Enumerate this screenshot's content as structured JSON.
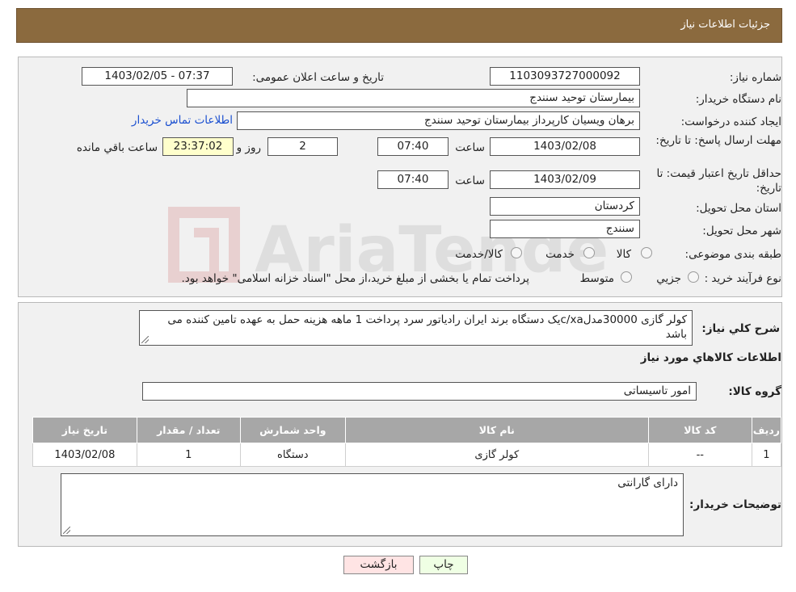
{
  "header": {
    "title": "جزئیات اطلاعات نیاز"
  },
  "form": {
    "need_number_label": "شماره نیاز:",
    "need_number": "1103093727000092",
    "announce_label": "تاریخ و ساعت اعلان عمومی:",
    "announce_value": "1403/02/05 - 07:37",
    "buyer_org_label": "نام دستگاه خریدار:",
    "buyer_org": "بیمارستان توحید سنندج",
    "creator_label": "ایجاد کننده درخواست:",
    "creator": "برهان ویسیان کارپرداز بیمارستان توحید سنندج",
    "contact_link": "اطلاعات تماس خریدار",
    "deadline_label": "مهلت ارسال پاسخ: تا تاریخ:",
    "deadline_date": "1403/02/08",
    "time_label": "ساعت",
    "deadline_time": "07:40",
    "days": "2",
    "days_label": "روز و",
    "remaining": "23:37:02",
    "remaining_label": "ساعت باقي مانده",
    "validity_label": "حداقل تاریخ اعتبار قیمت: تا تاریخ:",
    "validity_date": "1403/02/09",
    "validity_time": "07:40",
    "province_label": "استان محل تحویل:",
    "province": "کردستان",
    "city_label": "شهر محل تحویل:",
    "city": "سنندج",
    "category_label": "طبقه بندی موضوعی:",
    "category_options": [
      "کالا",
      "خدمت",
      "کالا/خدمت"
    ],
    "process_label": "نوع فرآیند خرید :",
    "process_options": [
      "جزیي",
      "متوسط"
    ],
    "process_note": "پرداخت تمام یا بخشی از مبلغ خرید،از محل \"اسناد خزانه اسلامی\" خواهد بود."
  },
  "details": {
    "summary_label": "شرح کلي نياز:",
    "summary": "کولر گازی 30000مدلc/xaیک دستگاه برند ایران رادیاتور سرد پرداخت 1 ماهه هزینه حمل به عهده تامین کننده می باشد",
    "items_title": "اطلاعات کالاهاي مورد نياز",
    "group_label": "گروه کالا:",
    "group": "امور تاسیساتی",
    "table": {
      "headers": [
        "رديف",
        "کد کالا",
        "نام کالا",
        "واحد شمارش",
        "تعداد / مقدار",
        "تاريخ نياز"
      ],
      "rows": [
        [
          "1",
          "--",
          "کولر گازی",
          "دستگاه",
          "1",
          "1403/02/08"
        ]
      ]
    },
    "buyer_notes_label": "توضيحات خريدار:",
    "buyer_notes": "دارای گارانتی"
  },
  "buttons": {
    "print": "چاپ",
    "back": "بازگشت"
  },
  "colors": {
    "header": "#8b6a3e",
    "link": "#1a4fd0",
    "table_header": "#a7a7a7",
    "back_button": "#ffe4e4",
    "print_button": "#efffe4"
  }
}
